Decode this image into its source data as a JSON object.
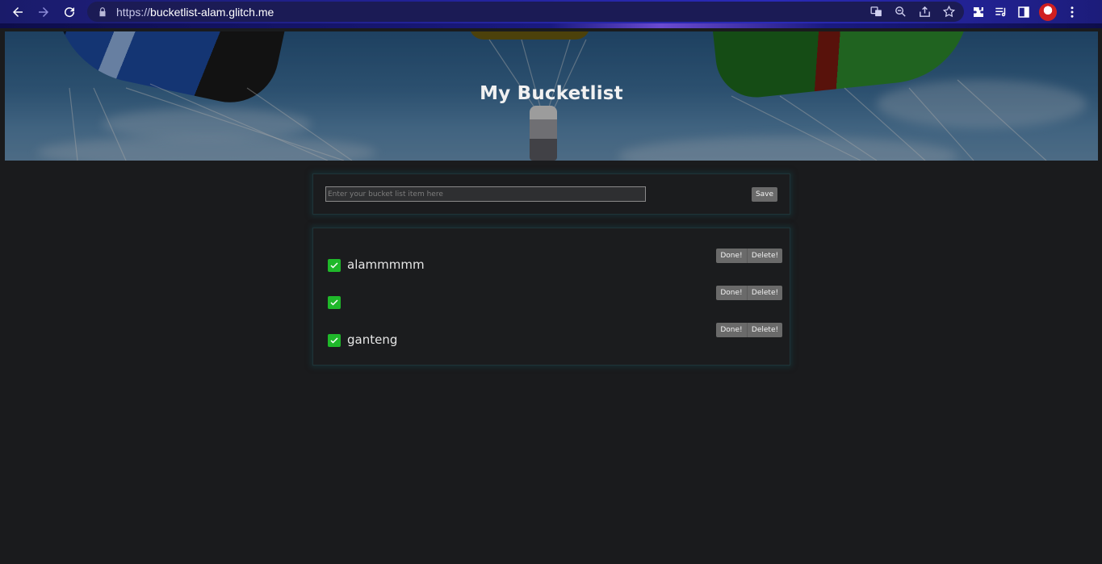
{
  "browser": {
    "url_scheme": "https://",
    "url_host": "bucketlist-alam.glitch.me"
  },
  "header": {
    "title": "My Bucketlist"
  },
  "form": {
    "placeholder": "Enter your bucket list item here",
    "value": "",
    "save_label": "Save"
  },
  "list": {
    "done_label": "Done!",
    "delete_label": "Delete!",
    "items": [
      {
        "text": "alammmmm",
        "checked": true
      },
      {
        "text": "",
        "checked": true
      },
      {
        "text": "ganteng",
        "checked": true
      }
    ]
  },
  "colors": {
    "page_bg": "#1a1b1d",
    "check_green": "#1fb82a",
    "button_gray": "#6a6a6a",
    "card_border": "#1f3438"
  }
}
